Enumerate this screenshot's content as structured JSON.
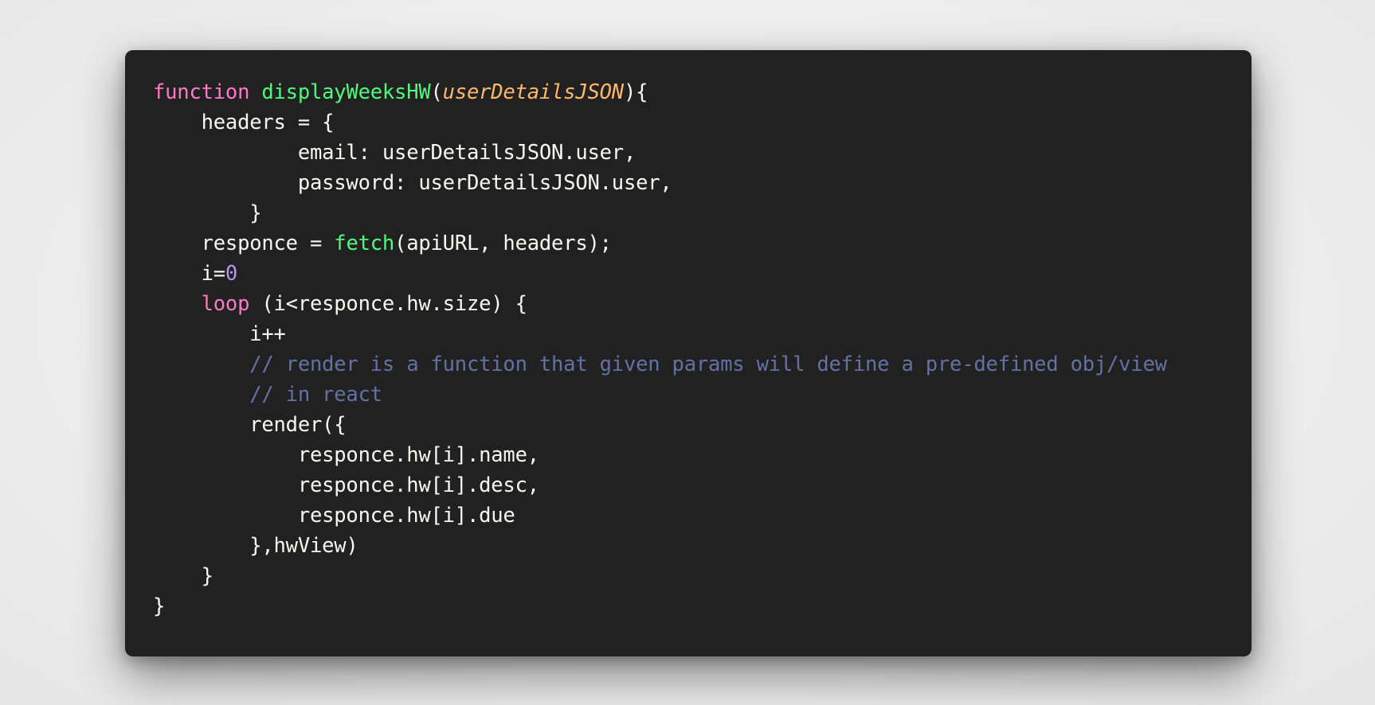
{
  "colors": {
    "background": "#212121",
    "page_background": "#eeeeee",
    "keyword": "#ff79c6",
    "function": "#50fa7b",
    "parameter": "#ffb86c",
    "number": "#bd93f9",
    "comment": "#6272a4",
    "plain": "#f8f8f2"
  },
  "code": {
    "language": "javascript",
    "lines": [
      [
        {
          "t": "keyword",
          "v": "function"
        },
        {
          "t": "plain",
          "v": " "
        },
        {
          "t": "func",
          "v": "displayWeeksHW"
        },
        {
          "t": "plain",
          "v": "("
        },
        {
          "t": "param",
          "v": "userDetailsJSON"
        },
        {
          "t": "plain",
          "v": "){"
        }
      ],
      [
        {
          "t": "plain",
          "v": "    headers = {"
        }
      ],
      [
        {
          "t": "plain",
          "v": "            email: userDetailsJSON.user,"
        }
      ],
      [
        {
          "t": "plain",
          "v": "            password: userDetailsJSON.user,"
        }
      ],
      [
        {
          "t": "plain",
          "v": "        }"
        }
      ],
      [
        {
          "t": "plain",
          "v": "    responce = "
        },
        {
          "t": "func",
          "v": "fetch"
        },
        {
          "t": "plain",
          "v": "(apiURL, headers);"
        }
      ],
      [
        {
          "t": "plain",
          "v": "    i="
        },
        {
          "t": "number",
          "v": "0"
        }
      ],
      [
        {
          "t": "plain",
          "v": "    "
        },
        {
          "t": "keyword",
          "v": "loop"
        },
        {
          "t": "plain",
          "v": " (i<responce.hw.size) {"
        }
      ],
      [
        {
          "t": "plain",
          "v": "        i++"
        }
      ],
      [
        {
          "t": "plain",
          "v": "        "
        },
        {
          "t": "comment",
          "v": "// render is a function that given params will define a pre-defined obj/view"
        }
      ],
      [
        {
          "t": "plain",
          "v": "        "
        },
        {
          "t": "comment",
          "v": "// in react"
        }
      ],
      [
        {
          "t": "plain",
          "v": "        render({"
        }
      ],
      [
        {
          "t": "plain",
          "v": "            responce.hw[i].name,"
        }
      ],
      [
        {
          "t": "plain",
          "v": "            responce.hw[i].desc,"
        }
      ],
      [
        {
          "t": "plain",
          "v": "            responce.hw[i].due"
        }
      ],
      [
        {
          "t": "plain",
          "v": "        },hwView)"
        }
      ],
      [
        {
          "t": "plain",
          "v": "    }"
        }
      ],
      [
        {
          "t": "plain",
          "v": "}"
        }
      ]
    ]
  }
}
